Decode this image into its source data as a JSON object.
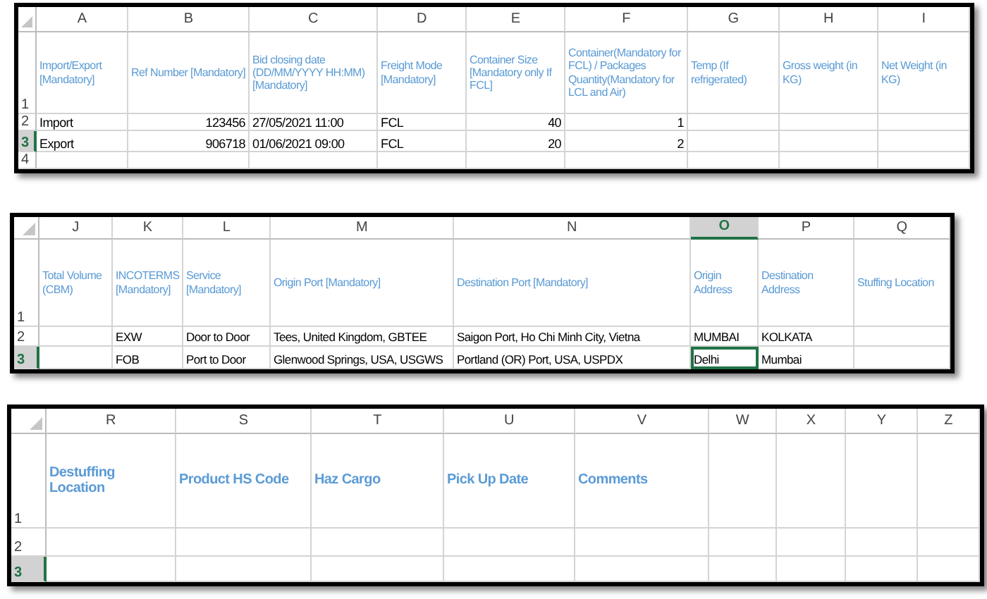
{
  "sheets": [
    {
      "columns": [
        {
          "letter": "A",
          "selected": false
        },
        {
          "letter": "B",
          "selected": false
        },
        {
          "letter": "C",
          "selected": false
        },
        {
          "letter": "D",
          "selected": false
        },
        {
          "letter": "E",
          "selected": false
        },
        {
          "letter": "F",
          "selected": false
        },
        {
          "letter": "G",
          "selected": false
        },
        {
          "letter": "H",
          "selected": false
        },
        {
          "letter": "I",
          "selected": false
        }
      ],
      "rows": [
        {
          "number": "1",
          "selected": false,
          "cells": [
            {
              "text": "Import/Export [Mandatory]",
              "kind": "header"
            },
            {
              "text": "Ref Number [Mandatory]",
              "kind": "header"
            },
            {
              "text": "Bid closing date (DD/MM/YYYY HH:MM) [Mandatory]",
              "kind": "header"
            },
            {
              "text": "Freight Mode [Mandatory]",
              "kind": "header"
            },
            {
              "text": "Container Size [Mandatory only If FCL]",
              "kind": "header"
            },
            {
              "text": "Container(Mandatory for FCL) / Packages Quantity(Mandatory for LCL and Air)",
              "kind": "header"
            },
            {
              "text": "Temp (If refrigerated)",
              "kind": "header"
            },
            {
              "text": "Gross weight (in KG)",
              "kind": "header"
            },
            {
              "text": "Net Weight (in KG)",
              "kind": "header"
            }
          ]
        },
        {
          "number": "2",
          "selected": false,
          "cells": [
            {
              "text": "Import",
              "kind": "text"
            },
            {
              "text": "123456",
              "kind": "number"
            },
            {
              "text": "27/05/2021 11:00",
              "kind": "text"
            },
            {
              "text": "FCL",
              "kind": "text"
            },
            {
              "text": "40",
              "kind": "number"
            },
            {
              "text": "1",
              "kind": "number"
            },
            null,
            null,
            null
          ]
        },
        {
          "number": "3",
          "selected": true,
          "cells": [
            {
              "text": "Export",
              "kind": "text"
            },
            {
              "text": "906718",
              "kind": "number"
            },
            {
              "text": "01/06/2021 09:00",
              "kind": "text"
            },
            {
              "text": "FCL",
              "kind": "text"
            },
            {
              "text": "20",
              "kind": "number"
            },
            {
              "text": "2",
              "kind": "number"
            },
            null,
            null,
            null
          ]
        },
        {
          "number": "4",
          "selected": false,
          "cells": [
            null,
            null,
            null,
            null,
            null,
            null,
            null,
            null,
            null
          ]
        }
      ]
    },
    {
      "columns": [
        {
          "letter": "J",
          "selected": false
        },
        {
          "letter": "K",
          "selected": false
        },
        {
          "letter": "L",
          "selected": false
        },
        {
          "letter": "M",
          "selected": false
        },
        {
          "letter": "N",
          "selected": false
        },
        {
          "letter": "O",
          "selected": true
        },
        {
          "letter": "P",
          "selected": false
        },
        {
          "letter": "Q",
          "selected": false
        }
      ],
      "rows": [
        {
          "number": "1",
          "selected": false,
          "cells": [
            {
              "text": "Total Volume (CBM)",
              "kind": "header"
            },
            {
              "text": "INCOTERMS [Mandatory]",
              "kind": "header"
            },
            {
              "text": "Service [Mandatory]",
              "kind": "header"
            },
            {
              "text": "Origin Port [Mandatory]",
              "kind": "header"
            },
            {
              "text": "Destination Port [Mandatory]",
              "kind": "header"
            },
            {
              "text": "Origin Address",
              "kind": "header"
            },
            {
              "text": "Destination Address",
              "kind": "header"
            },
            {
              "text": "Stuffing Location",
              "kind": "header"
            }
          ]
        },
        {
          "number": "2",
          "selected": false,
          "cells": [
            null,
            {
              "text": "EXW",
              "kind": "text"
            },
            {
              "text": "Door to Door",
              "kind": "text"
            },
            {
              "text": "Tees, United Kingdom, GBTEE",
              "kind": "text"
            },
            {
              "text": "Saigon  Port, Ho Chi Minh City, Vietna",
              "kind": "text"
            },
            {
              "text": "MUMBAI",
              "kind": "text"
            },
            {
              "text": "KOLKATA",
              "kind": "text"
            },
            null
          ]
        },
        {
          "number": "3",
          "selected": true,
          "cells": [
            null,
            {
              "text": "FOB",
              "kind": "text"
            },
            {
              "text": "Port to Door",
              "kind": "text"
            },
            {
              "text": "Glenwood Springs, USA, USGWS",
              "kind": "text"
            },
            {
              "text": "Portland (OR) Port, USA, USPDX",
              "kind": "text"
            },
            {
              "text": "Delhi",
              "kind": "text",
              "selected": true
            },
            {
              "text": "Mumbai",
              "kind": "text"
            },
            null
          ]
        }
      ]
    },
    {
      "columns": [
        {
          "letter": "R",
          "selected": false
        },
        {
          "letter": "S",
          "selected": false
        },
        {
          "letter": "T",
          "selected": false
        },
        {
          "letter": "U",
          "selected": false
        },
        {
          "letter": "V",
          "selected": false
        },
        {
          "letter": "W",
          "selected": false
        },
        {
          "letter": "X",
          "selected": false
        },
        {
          "letter": "Y",
          "selected": false
        },
        {
          "letter": "Z",
          "selected": false
        }
      ],
      "rows": [
        {
          "number": "1",
          "selected": false,
          "cells": [
            {
              "text": "Destuffing Location",
              "kind": "header"
            },
            {
              "text": "Product HS Code",
              "kind": "header"
            },
            {
              "text": "Haz Cargo",
              "kind": "header"
            },
            {
              "text": "Pick Up Date",
              "kind": "header"
            },
            {
              "text": "Comments",
              "kind": "header"
            },
            null,
            null,
            null,
            null
          ]
        },
        {
          "number": "2",
          "selected": false,
          "cells": [
            null,
            null,
            null,
            null,
            null,
            null,
            null,
            null,
            null
          ]
        },
        {
          "number": "3",
          "selected": true,
          "cells": [
            null,
            null,
            null,
            null,
            null,
            null,
            null,
            null,
            null
          ]
        }
      ]
    }
  ]
}
